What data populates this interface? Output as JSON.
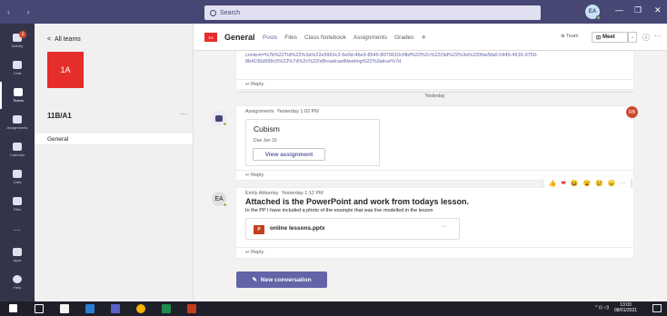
{
  "titlebar": {
    "search_placeholder": "Search",
    "user_initials": "EA"
  },
  "appbar": {
    "items": [
      {
        "label": "Activity",
        "badge": "1"
      },
      {
        "label": "Chat"
      },
      {
        "label": "Teams"
      },
      {
        "label": "Assignments"
      },
      {
        "label": "Calendar"
      },
      {
        "label": "Calls"
      },
      {
        "label": "Files"
      },
      {
        "label": "..."
      },
      {
        "label": "Apps"
      },
      {
        "label": "Help"
      }
    ]
  },
  "sidebar": {
    "back_label": "All teams",
    "team_tile": "1A",
    "team_name": "11B/A1",
    "more": "···",
    "channels": [
      "General"
    ]
  },
  "channel_header": {
    "tile": "1A",
    "title": "General",
    "tabs": [
      "Posts",
      "Files",
      "Class Notebook",
      "Assignments",
      "Grades"
    ],
    "add_tab": "+",
    "team_label": "Team",
    "meet_label": "Meet",
    "more": "···"
  },
  "feed": {
    "link_text": "context=%7b%22Tid%22%3a%22e5963c2-6e0d-46e9-8549-8070010cf4bf%22%2c%22Oid%22%3a%220fae5fa0-0445-4916-9759-8b4106d999c5%22%7d%2c%22IsBroadcastMeeting%22%3atrue%7d",
    "reply_label": "Reply",
    "divider_label": "Yesterday",
    "assignment_msg": {
      "author": "Assignments",
      "time": "Yesterday 1:02 PM",
      "card_title": "Cubism",
      "due": "Due Jan 10",
      "button": "View assignment",
      "badge": "RB"
    },
    "reactions": [
      "👍",
      "❤",
      "😆",
      "😮",
      "😢",
      "😠",
      "···"
    ],
    "lesson_msg": {
      "avatar": "EA",
      "author": "Emily Abberley",
      "time": "Yesterday 1:12 PM",
      "subject": "Attached is the PowerPoint and work from todays lesson.",
      "body": "In the PP I have included a photo of the example that was live modelled in the lesson",
      "file_name": "online lessons.pptx",
      "file_more": "···"
    },
    "new_conversation": "New conversation"
  },
  "taskbar": {
    "time": "13:03",
    "date": "08/01/2021"
  },
  "colors": {
    "titlebar": "#464775",
    "appbar": "#33344a",
    "accent": "#6264a7",
    "team_red": "#e52e2b"
  }
}
